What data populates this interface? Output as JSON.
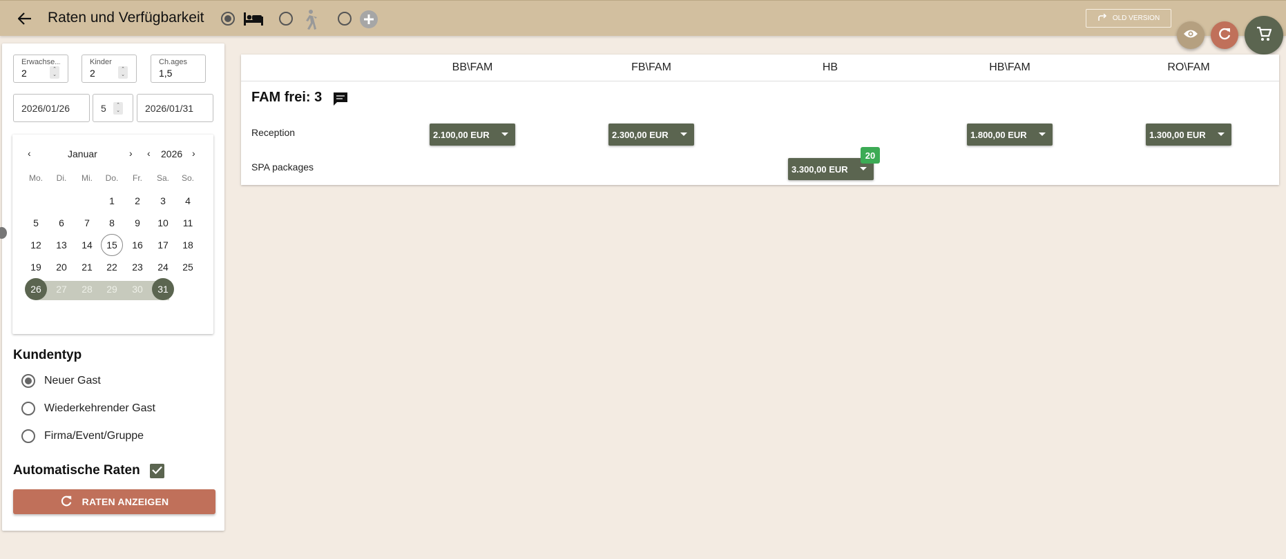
{
  "header": {
    "title": "Raten und Verfügbarkeit",
    "old_version_label": "OLD VERSION"
  },
  "guests": {
    "adults_label": "Erwachse...",
    "adults_value": "2",
    "children_label": "Kinder",
    "children_value": "2",
    "ages_label": "Ch.ages",
    "ages_value": "1,5"
  },
  "dates": {
    "arrival": "2026/01/26",
    "nights": "5",
    "departure": "2026/01/31"
  },
  "calendar": {
    "month": "Januar",
    "year": "2026",
    "weekdays": [
      "Mo.",
      "Di.",
      "Mi.",
      "Do.",
      "Fr.",
      "Sa.",
      "So."
    ],
    "weeks": [
      [
        "",
        "",
        "",
        "1",
        "2",
        "3",
        "4"
      ],
      [
        "5",
        "6",
        "7",
        "8",
        "9",
        "10",
        "11"
      ],
      [
        "12",
        "13",
        "14",
        "15",
        "16",
        "17",
        "18"
      ],
      [
        "19",
        "20",
        "21",
        "22",
        "23",
        "24",
        "25"
      ],
      [
        "26",
        "27",
        "28",
        "29",
        "30",
        "31",
        ""
      ]
    ],
    "today": "15",
    "range_start": "26",
    "range_end": "31"
  },
  "customer_type": {
    "title": "Kundentyp",
    "options": [
      "Neuer Gast",
      "Wiederkehrender Gast",
      "Firma/Event/Gruppe"
    ],
    "selected": "Neuer Gast"
  },
  "auto_rates": {
    "label": "Automatische Raten",
    "checked": true
  },
  "show_rates_button": "RATEN ANZEIGEN",
  "rates_table": {
    "columns": [
      "BB\\FAM",
      "FB\\FAM",
      "HB",
      "HB\\FAM",
      "RO\\FAM"
    ],
    "room_title": "FAM frei: 3",
    "rows": [
      {
        "label": "Reception",
        "prices": [
          "2.100,00 EUR",
          "2.300,00 EUR",
          "",
          "1.800,00 EUR",
          "1.300,00 EUR"
        ]
      },
      {
        "label": "SPA packages",
        "prices": [
          "",
          "",
          "3.300,00 EUR",
          "",
          ""
        ],
        "badge": "20"
      }
    ]
  },
  "colors": {
    "header_bg": "#d2bf9f",
    "page_bg": "#f3ebe2",
    "primary_green": "#5b6550",
    "accent_red": "#c0705a",
    "badge_green": "#3cab55"
  },
  "icons": [
    "back-arrow-icon",
    "bed-icon",
    "walking-person-icon",
    "add-circle-icon",
    "redo-arrow-icon",
    "eye-icon",
    "refresh-icon",
    "cart-icon",
    "chat-icon",
    "check-icon"
  ]
}
